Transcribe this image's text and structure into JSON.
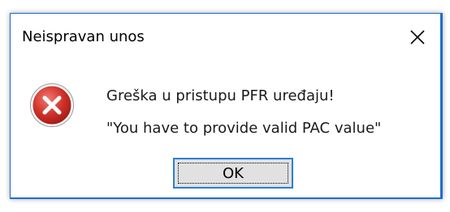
{
  "dialog": {
    "title": "Neispravan unos",
    "close_icon": "close-icon",
    "icon": "error-icon",
    "message_line1": "Greška u pristupu PFR uređaju!",
    "message_line2": "\"You have to provide valid PAC value\"",
    "ok_label": "OK"
  },
  "colors": {
    "border_accent": "#1a6fd0",
    "error_red": "#d4302a",
    "button_focus": "#2a7fd4"
  }
}
